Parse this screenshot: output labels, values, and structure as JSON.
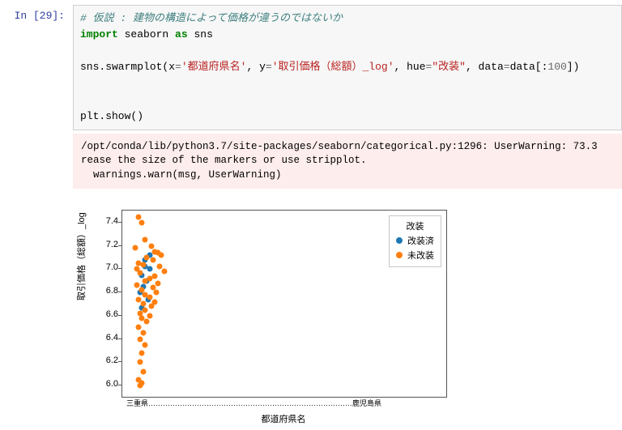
{
  "prompt": "In [29]:",
  "code": {
    "comment": "# 仮説 : 建物の構造によって価格が違うのではないか",
    "kw_import": "import",
    "mod_seaborn": "seaborn",
    "kw_as": "as",
    "alias_sns": "sns",
    "line2_prefix": "sns.swarmplot(x",
    "eq": "=",
    "str_x": "'都道府県名'",
    "sep": ", ",
    "arg_y": "y",
    "str_y": "'取引価格（総額）_log'",
    "arg_hue": "hue",
    "str_hue": "\"改装\"",
    "arg_data": "data",
    "val_data": "data[:",
    "num_100": "100",
    "close": "])",
    "line_show": "plt.show()"
  },
  "warning": "/opt/conda/lib/python3.7/site-packages/seaborn/categorical.py:1296: UserWarning: 73.3\nrease the size of the markers or use stripplot.\n  warnings.warn(msg, UserWarning)",
  "chart_data": {
    "type": "scatter",
    "xlabel": "都道府県名",
    "ylabel": "取引価格（総額）_log",
    "ylim": [
      5.9,
      7.5
    ],
    "yticks": [
      6.0,
      6.2,
      6.4,
      6.6,
      6.8,
      7.0,
      7.2,
      7.4
    ],
    "legend": {
      "title": "改装",
      "items": [
        {
          "name": "改装済",
          "color": "#1f77b4"
        },
        {
          "name": "未改装",
          "color": "#ff7f0e"
        }
      ]
    },
    "xcategories_note": "多数の都道府県名がx軸に重なって表示（三重県…鹿児島県 等）",
    "xtick_rendered": "三重県…………………………………………………………………………鹿児島県",
    "series": [
      {
        "name": "改装済",
        "color": "#1f77b4",
        "points": [
          {
            "x": 0.07,
            "y": 7.02
          },
          {
            "x": 0.085,
            "y": 7.0
          },
          {
            "x": 0.06,
            "y": 6.95
          },
          {
            "x": 0.075,
            "y": 6.9
          },
          {
            "x": 0.065,
            "y": 6.85
          },
          {
            "x": 0.055,
            "y": 6.8
          },
          {
            "x": 0.08,
            "y": 6.74
          },
          {
            "x": 0.06,
            "y": 6.67
          },
          {
            "x": 0.07,
            "y": 7.08
          },
          {
            "x": 0.085,
            "y": 7.12
          }
        ]
      },
      {
        "name": "未改装",
        "color": "#ff7f0e",
        "points": [
          {
            "x": 0.05,
            "y": 7.45
          },
          {
            "x": 0.06,
            "y": 7.4
          },
          {
            "x": 0.07,
            "y": 7.25
          },
          {
            "x": 0.09,
            "y": 7.2
          },
          {
            "x": 0.04,
            "y": 7.18
          },
          {
            "x": 0.1,
            "y": 7.15
          },
          {
            "x": 0.11,
            "y": 7.14
          },
          {
            "x": 0.12,
            "y": 7.12
          },
          {
            "x": 0.075,
            "y": 7.1
          },
          {
            "x": 0.095,
            "y": 7.08
          },
          {
            "x": 0.05,
            "y": 7.05
          },
          {
            "x": 0.065,
            "y": 7.04
          },
          {
            "x": 0.115,
            "y": 7.02
          },
          {
            "x": 0.045,
            "y": 7.0
          },
          {
            "x": 0.13,
            "y": 6.98
          },
          {
            "x": 0.055,
            "y": 6.97
          },
          {
            "x": 0.1,
            "y": 6.94
          },
          {
            "x": 0.085,
            "y": 6.92
          },
          {
            "x": 0.07,
            "y": 6.9
          },
          {
            "x": 0.11,
            "y": 6.88
          },
          {
            "x": 0.045,
            "y": 6.86
          },
          {
            "x": 0.095,
            "y": 6.84
          },
          {
            "x": 0.06,
            "y": 6.82
          },
          {
            "x": 0.105,
            "y": 6.8
          },
          {
            "x": 0.07,
            "y": 6.78
          },
          {
            "x": 0.085,
            "y": 6.76
          },
          {
            "x": 0.05,
            "y": 6.74
          },
          {
            "x": 0.1,
            "y": 6.72
          },
          {
            "x": 0.065,
            "y": 6.7
          },
          {
            "x": 0.09,
            "y": 6.68
          },
          {
            "x": 0.07,
            "y": 6.65
          },
          {
            "x": 0.055,
            "y": 6.62
          },
          {
            "x": 0.085,
            "y": 6.6
          },
          {
            "x": 0.06,
            "y": 6.58
          },
          {
            "x": 0.075,
            "y": 6.55
          },
          {
            "x": 0.05,
            "y": 6.5
          },
          {
            "x": 0.065,
            "y": 6.45
          },
          {
            "x": 0.055,
            "y": 6.4
          },
          {
            "x": 0.07,
            "y": 6.35
          },
          {
            "x": 0.06,
            "y": 6.28
          },
          {
            "x": 0.055,
            "y": 6.2
          },
          {
            "x": 0.065,
            "y": 6.12
          },
          {
            "x": 0.05,
            "y": 6.05
          },
          {
            "x": 0.06,
            "y": 6.02
          },
          {
            "x": 0.055,
            "y": 6.0
          }
        ]
      }
    ]
  }
}
